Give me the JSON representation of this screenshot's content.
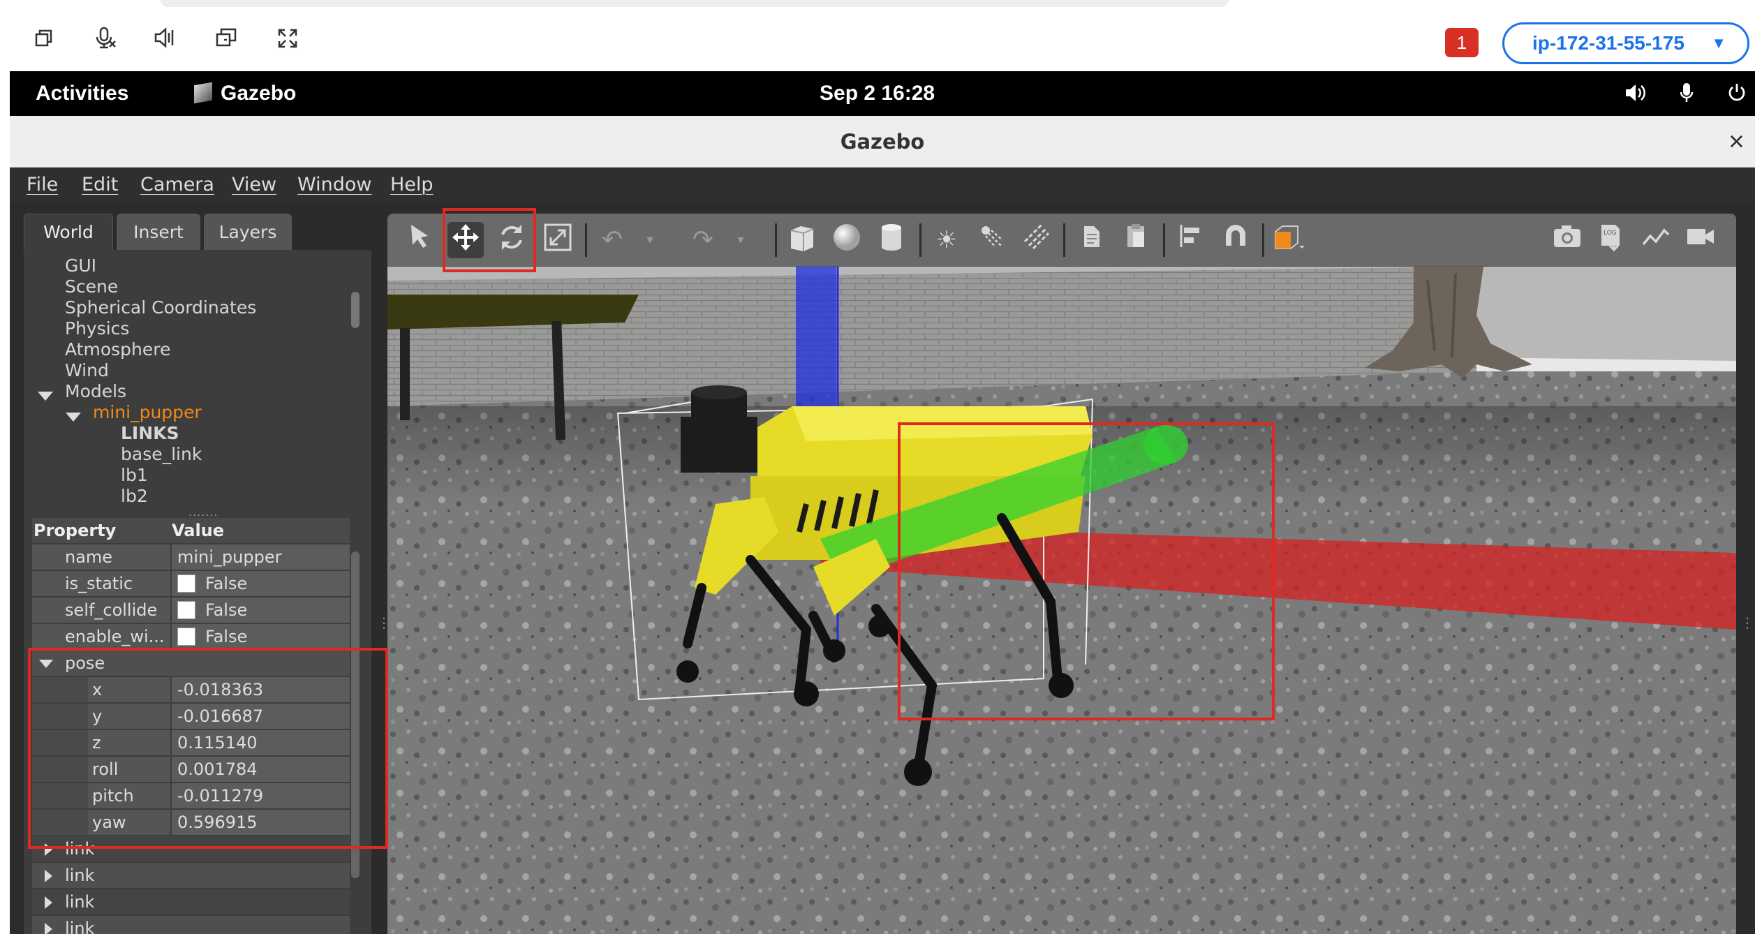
{
  "client_bar": {
    "icons": [
      "window-restore-icon",
      "mic-muted-icon",
      "speaker-icon",
      "multi-window-icon",
      "fullscreen-icon"
    ],
    "notification_count": "1",
    "host": "ip-172-31-55-175"
  },
  "gnome": {
    "activities": "Activities",
    "app_name": "Gazebo",
    "datetime": "Sep 2  16:28"
  },
  "window": {
    "title": "Gazebo",
    "close": "×"
  },
  "menu": [
    "File",
    "Edit",
    "Camera",
    "View",
    "Window",
    "Help"
  ],
  "left_tabs": [
    "World",
    "Insert",
    "Layers"
  ],
  "tree": {
    "items": [
      "GUI",
      "Scene",
      "Spherical Coordinates",
      "Physics",
      "Atmosphere",
      "Wind"
    ],
    "models_label": "Models",
    "model_name": "mini_pupper",
    "links_header": "LINKS",
    "links": [
      "base_link",
      "lb1",
      "lb2"
    ]
  },
  "properties": {
    "col_property": "Property",
    "col_value": "Value",
    "name": {
      "key": "name",
      "value": "mini_pupper"
    },
    "is_static": {
      "key": "is_static",
      "value": "False"
    },
    "self_collide": {
      "key": "self_collide",
      "value": "False"
    },
    "enable_wind": {
      "key": "enable_wi...",
      "value": "False"
    },
    "pose": {
      "label": "pose",
      "x": {
        "key": "x",
        "value": "-0.018363"
      },
      "y": {
        "key": "y",
        "value": "-0.016687"
      },
      "z": {
        "key": "z",
        "value": "0.115140"
      },
      "roll": {
        "key": "roll",
        "value": "0.001784"
      },
      "pitch": {
        "key": "pitch",
        "value": "-0.011279"
      },
      "yaw": {
        "key": "yaw",
        "value": "0.596915"
      }
    },
    "collapsed": [
      "link",
      "link",
      "link",
      "link"
    ]
  },
  "toolbar": {
    "tools": [
      "select-mode",
      "translate-mode",
      "rotate-mode",
      "scale-mode",
      "undo",
      "redo",
      "box-shape",
      "sphere-shape",
      "cylinder-shape",
      "point-light",
      "spot-light",
      "directional-light",
      "copy",
      "paste",
      "align",
      "snap",
      "view-angle"
    ],
    "right_tools": [
      "screenshot",
      "log",
      "plot",
      "record-video"
    ]
  },
  "colors": {
    "highlight": "#e02a20",
    "robot_body": "#e6dc28",
    "axis_x": "#d62020",
    "axis_y": "#30d030",
    "axis_z": "#2030e0",
    "selected_model": "#f08a1b"
  }
}
